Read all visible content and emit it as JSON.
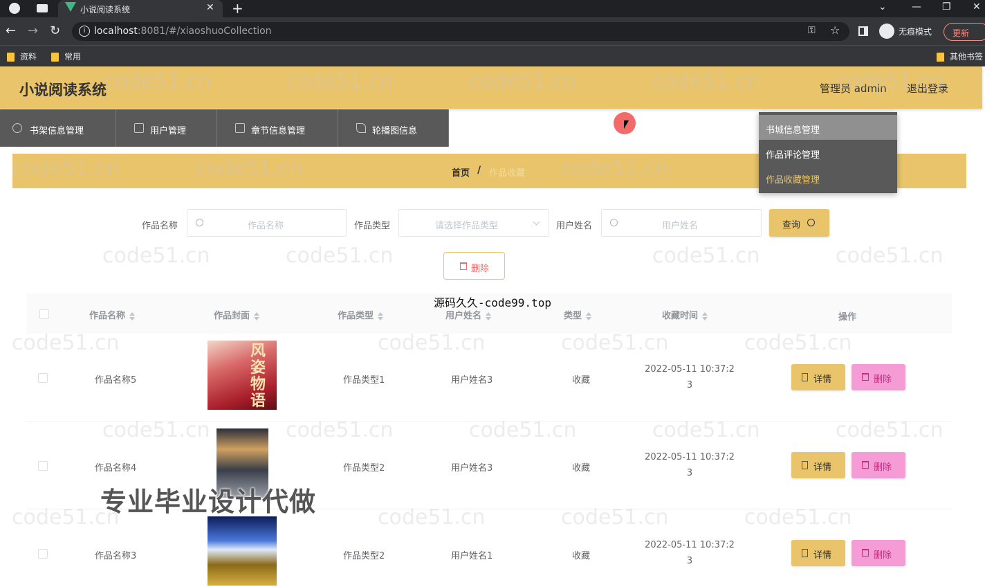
{
  "browser": {
    "tab_title": "小说阅读系统",
    "tab_close": "✕",
    "tab_new": "+",
    "url_host": "localhost",
    "url_rest": ":8081/#/xiaoshuoCollection",
    "incognito": "无痕模式",
    "update": "更新",
    "bookmarks": [
      "资料",
      "常用"
    ],
    "other_bookmarks": "其他书签"
  },
  "app": {
    "title": "小说阅读系统",
    "admin": "管理员 admin",
    "logout": "退出登录"
  },
  "nav": {
    "items": [
      {
        "label": "书架信息管理"
      },
      {
        "label": "用户管理"
      },
      {
        "label": "章节信息管理"
      },
      {
        "label": "轮播图信息"
      }
    ],
    "dropdown": [
      {
        "label": "书城信息管理"
      },
      {
        "label": "作品评论管理"
      },
      {
        "label": "作品收藏管理"
      }
    ]
  },
  "breadcrumb": {
    "home": "首页",
    "separator": "/",
    "current": "作品收藏"
  },
  "search": {
    "name_label": "作品名称",
    "name_placeholder": "作品名称",
    "type_label": "作品类型",
    "type_placeholder": "请选择作品类型",
    "user_label": "用户姓名",
    "user_placeholder": "用户姓名",
    "query_button": "查询"
  },
  "actions": {
    "batch_delete": "删除"
  },
  "table": {
    "columns": [
      "作品名称",
      "作品封面",
      "作品类型",
      "用户姓名",
      "类型",
      "收藏时间",
      "操作"
    ],
    "rows": [
      {
        "name": "作品名称5",
        "type": "作品类型1",
        "user": "用户姓名3",
        "kind": "收藏",
        "time_1": "2022-05-11 10:37:2",
        "time_2": "3",
        "cover_text": "风姿物语"
      },
      {
        "name": "作品名称4",
        "type": "作品类型2",
        "user": "用户姓名3",
        "kind": "收藏",
        "time_1": "2022-05-11 10:37:2",
        "time_2": "3",
        "cover_text": ""
      },
      {
        "name": "作品名称3",
        "type": "作品类型2",
        "user": "用户姓名1",
        "kind": "收藏",
        "time_1": "2022-05-11 10:37:2",
        "time_2": "3",
        "cover_text": ""
      }
    ],
    "detail_button": "详情",
    "delete_button": "删除"
  },
  "overlays": {
    "mid_text": "源码久久-code99.top",
    "big_text": "专业毕业设计代做",
    "watermark": "code51.cn"
  }
}
